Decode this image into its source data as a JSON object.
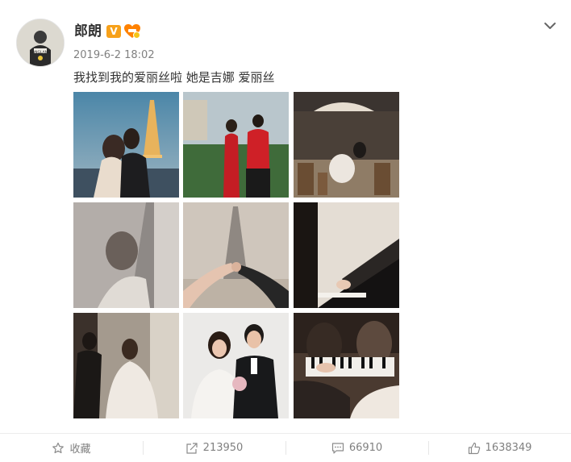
{
  "post": {
    "author": "郎朗",
    "vip_label": "V",
    "time": "2019-6-2 18:02",
    "text": "我找到我的爱丽丝啦 她是吉娜 爱丽丝",
    "avatar_text": "LANGLANG"
  },
  "icons": {
    "more": "chevron-down-icon",
    "favorite": "star-icon",
    "repost": "share-arrow-icon",
    "comment": "comment-icon",
    "like": "thumbs-up-icon"
  },
  "actions": {
    "favorite_label": "收藏",
    "repost_count": "213950",
    "comment_count": "66910",
    "like_count": "1638349"
  },
  "colors": {
    "vip": "#f7a11a",
    "text": "#333333",
    "muted": "#808080"
  }
}
